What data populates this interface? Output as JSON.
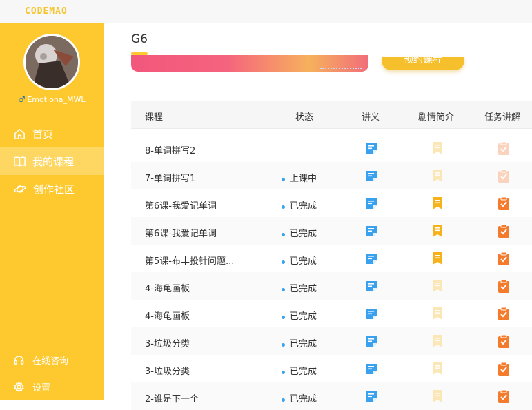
{
  "app": {
    "logo": "CODEMAO"
  },
  "user": {
    "gender_symbol": "♂",
    "name": "Emotiona_MWL"
  },
  "nav": {
    "items": [
      {
        "label": "首页",
        "icon": "home-icon",
        "active": false
      },
      {
        "label": "我的课程",
        "icon": "book-icon",
        "active": true
      },
      {
        "label": "创作社区",
        "icon": "planet-icon",
        "active": false
      }
    ],
    "bottom": [
      {
        "label": "在线咨询",
        "icon": "headset-icon"
      },
      {
        "label": "设置",
        "icon": "gear-icon"
      }
    ]
  },
  "main": {
    "title": "G6",
    "banner_button": "预约课程"
  },
  "table": {
    "headers": [
      "课程",
      "状态",
      "讲义",
      "剧情简介",
      "任务讲解"
    ],
    "rows": [
      {
        "course": "8-单词拼写2",
        "status": "",
        "plot_available": false,
        "task_available": false
      },
      {
        "course": "7-单词拼写1",
        "status": "上课中",
        "plot_available": false,
        "task_available": false
      },
      {
        "course": "第6课-我爱记单词",
        "status": "已完成",
        "plot_available": true,
        "task_available": true
      },
      {
        "course": "第6课-我爱记单词",
        "status": "已完成",
        "plot_available": true,
        "task_available": true
      },
      {
        "course": "第5课-布丰投针问题...",
        "status": "已完成",
        "plot_available": true,
        "task_available": true
      },
      {
        "course": "4-海龟画板",
        "status": "已完成",
        "plot_available": false,
        "task_available": true
      },
      {
        "course": "4-海龟画板",
        "status": "已完成",
        "plot_available": false,
        "task_available": true
      },
      {
        "course": "3-垃圾分类",
        "status": "已完成",
        "plot_available": false,
        "task_available": true
      },
      {
        "course": "3-垃圾分类",
        "status": "已完成",
        "plot_available": false,
        "task_available": true
      },
      {
        "course": "2-谁是下一个",
        "status": "已完成",
        "plot_available": false,
        "task_available": true
      }
    ]
  },
  "colors": {
    "brand_yellow": "#fec92f",
    "nav_active": "#fed763",
    "status_dot": "#36a3f0",
    "handout_blue": "#3aa1ee",
    "plot_gold": "#f5b21a",
    "plot_faded": "#fbe6b5",
    "task_orange": "#f47b2b",
    "task_faded": "#fbd3bd"
  }
}
